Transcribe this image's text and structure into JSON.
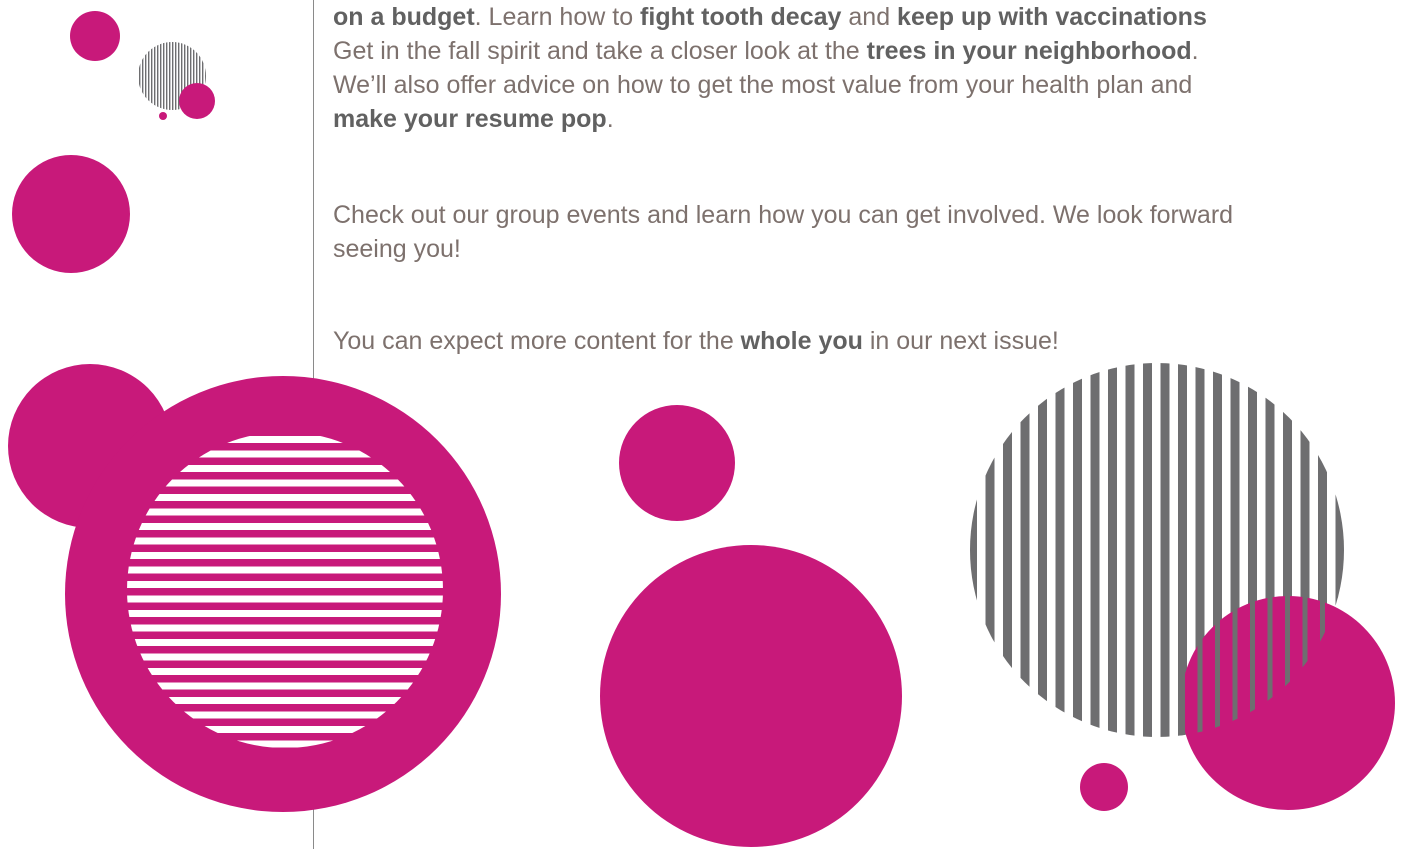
{
  "article": {
    "para1": {
      "line1": [
        {
          "t": "on a budget",
          "b": true
        },
        {
          "t": ". Learn how to ",
          "b": false
        },
        {
          "t": "fight tooth decay",
          "b": true
        },
        {
          "t": " and ",
          "b": false
        },
        {
          "t": "keep up with vaccinations",
          "b": true
        }
      ],
      "line2": [
        {
          "t": "Get in the fall spirit and take a closer look at the ",
          "b": false
        },
        {
          "t": "trees in your neighborhood",
          "b": true
        },
        {
          "t": ".",
          "b": false
        }
      ],
      "line3": [
        {
          "t": "We’ll also offer advice on how to get the most value from your health plan and",
          "b": false
        }
      ],
      "line4": [
        {
          "t": "make your resume pop",
          "b": true
        },
        {
          "t": ".",
          "b": false
        }
      ]
    },
    "para2": {
      "line1": "Check out our group events and learn how you can get involved. We look forward",
      "line2": "seeing you!"
    },
    "para3": {
      "prefix": "You can expect more content for the ",
      "bold": "whole you",
      "suffix": " in our next issue!"
    }
  },
  "decor": {
    "accent_color": "#c8197a",
    "stripe_gray": "#6e6e70",
    "stripe_white": "#ffffff",
    "divider_color": "#8a8a8a"
  }
}
